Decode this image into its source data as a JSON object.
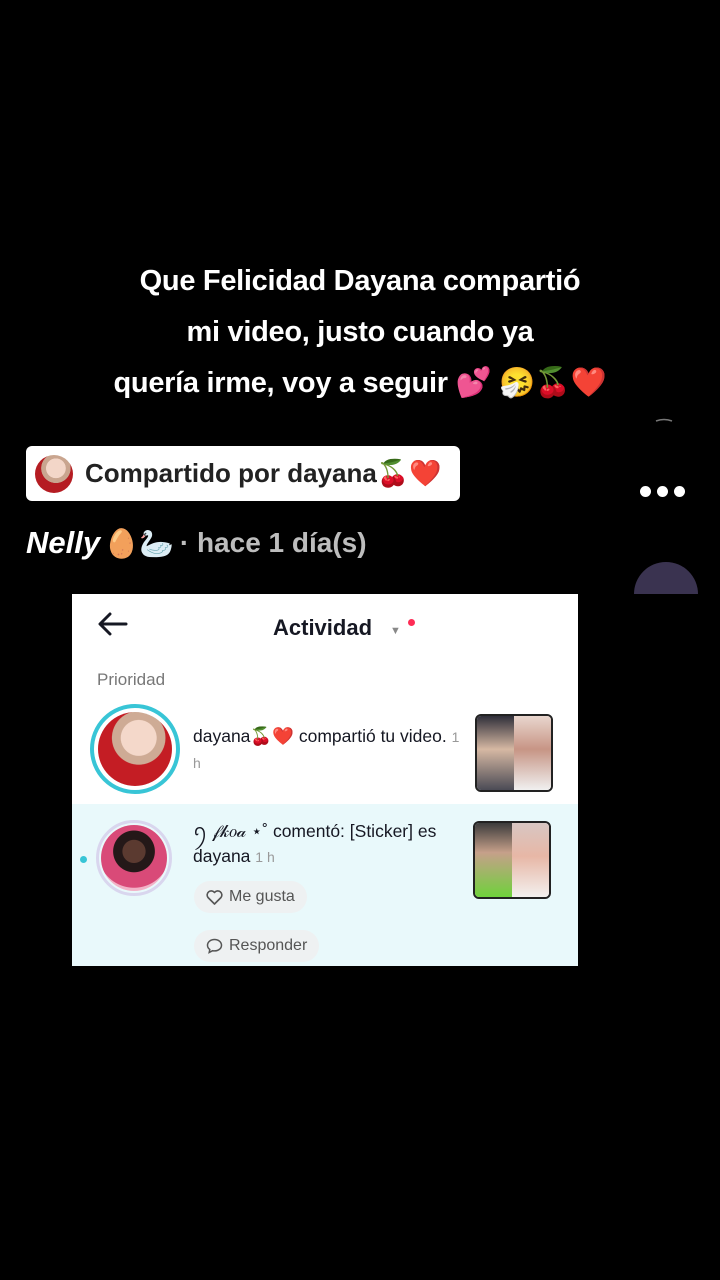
{
  "caption": {
    "lines": [
      "Que Felicidad Dayana compartió",
      "mi video, justo cuando ya",
      "quería irme, voy a seguir 💕 🤧🍒❤️"
    ]
  },
  "shared_by": {
    "text": "Compartido por dayana🍒❤️"
  },
  "author": {
    "name": "Nelly",
    "decoration": "🥚🦢",
    "meta": "· hace 1 día(s)"
  },
  "screenshot": {
    "title": "Actividad",
    "section_label": "Prioridad",
    "notifications": [
      {
        "user": "dayana🍒❤️",
        "text": "compartió tu video.",
        "time": "1 h"
      },
      {
        "user": "ꪆ 𝒻𝓀𝑜𝒶 ⋆˚",
        "text": "comentó: [Sticker] es dayana",
        "time": "1 h",
        "actions": {
          "like": "Me gusta",
          "reply": "Responder"
        }
      }
    ]
  },
  "colors": {
    "background": "#000000",
    "accent_ring": "#38c5d6",
    "notification_dot": "#fe2c55",
    "highlight_row": "#e9f9fb"
  },
  "icons": [
    "more-dots-icon",
    "back-arrow-icon",
    "heart-outline-icon",
    "comment-bubble-icon"
  ]
}
